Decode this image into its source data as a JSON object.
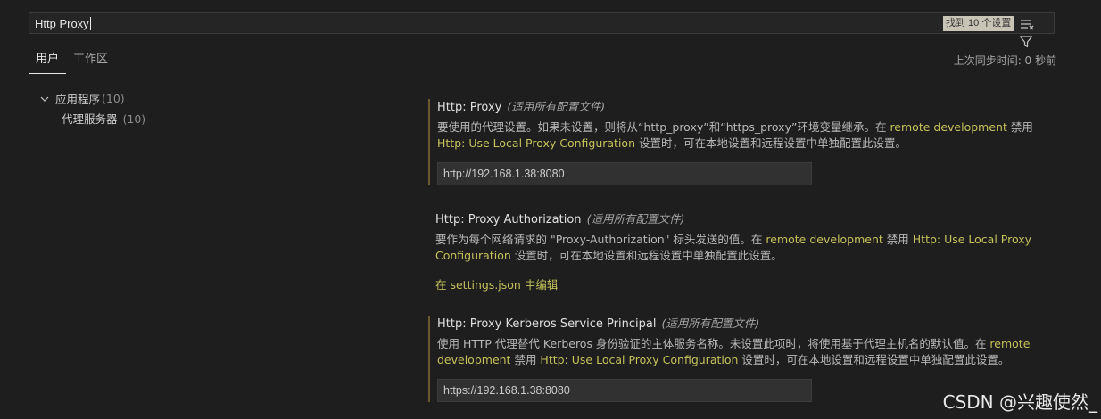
{
  "search": {
    "value": "Http Proxy",
    "results_badge": "找到 10 个设置"
  },
  "tabs": [
    {
      "label": "用户",
      "active": true
    },
    {
      "label": "工作区",
      "active": false
    }
  ],
  "sync_status": "上次同步时间: 0 秒前",
  "tree": {
    "root": {
      "label": "应用程序",
      "count": "(10)"
    },
    "child": {
      "label": "代理服务器",
      "count": "(10)"
    }
  },
  "settings": [
    {
      "title": "Http: Proxy",
      "scope": "(适用所有配置文件)",
      "desc_parts": [
        "要使用的代理设置。如果未设置，则将从“http_proxy”和“https_proxy”环境变量继承。在 ",
        "remote development",
        " 禁用 ",
        "Http: Use Local Proxy Configuration",
        " 设置时，可在本地设置和远程设置中单独配置此设置。"
      ],
      "value": "http://192.168.1.38:8080"
    },
    {
      "title": "Http: Proxy Authorization",
      "scope": "(适用所有配置文件)",
      "desc_parts": [
        "要作为每个网络请求的 \"Proxy-Authorization\" 标头发送的值。在 ",
        "remote development",
        " 禁用 ",
        "Http: Use Local Proxy Configuration",
        " 设置时，可在本地设置和远程设置中单独配置此设置。"
      ],
      "edit_link": "在 settings.json 中编辑"
    },
    {
      "title": "Http: Proxy Kerberos Service Principal",
      "scope": "(适用所有配置文件)",
      "desc_parts": [
        "使用 HTTP 代理替代 Kerberos 身份验证的主体服务名称。未设置此项时，将使用基于代理主机名的默认值。在 ",
        "remote development",
        " 禁用 ",
        "Http: Use Local Proxy Configuration",
        " 设置时，可在本地设置和远程设置中单独配置此设置。"
      ],
      "value": "https://192.168.1.38:8080"
    }
  ],
  "watermark": "CSDN @兴趣使然_",
  "colors": {
    "background": "#1e1e1e",
    "link": "#c5c25a",
    "modified_bar": "#6b5830"
  },
  "icons": [
    "clear-filter-icon",
    "filter-icon",
    "chevron-down-icon"
  ]
}
